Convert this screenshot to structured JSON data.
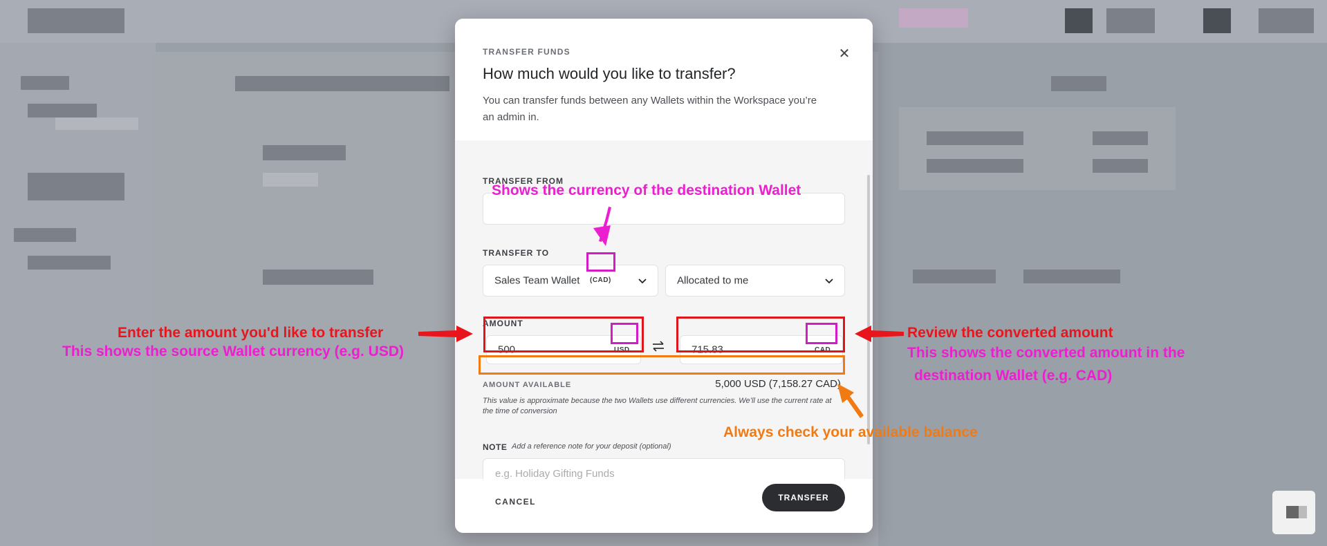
{
  "modal": {
    "eyebrow": "TRANSFER FUNDS",
    "title": "How much would you like to transfer?",
    "subtitle": "You can transfer funds between any Wallets within the Workspace you’re an admin in.",
    "close_icon": "close-icon",
    "transfer_from": {
      "label": "TRANSFER FROM",
      "value": ""
    },
    "transfer_to": {
      "label": "TRANSFER TO",
      "wallet_value": "Sales Team Wallet",
      "wallet_currency": "(CAD)",
      "allocation_value": "Allocated to me"
    },
    "amount": {
      "label": "AMOUNT",
      "source_value": "500",
      "source_currency": "USD",
      "converted_value": "715.83",
      "converted_currency": "CAD",
      "swap_icon": "swap-arrows-icon"
    },
    "available": {
      "label": "AMOUNT AVAILABLE",
      "value": "5,000 USD (7,158.27 CAD)",
      "disclaimer": "This value is approximate because the two Wallets use different currencies. We’ll use the current rate at the time of conversion"
    },
    "note": {
      "label": "NOTE",
      "hint": "Add a reference note for your deposit (optional)",
      "placeholder": "e.g. Holiday Gifting Funds"
    },
    "footer": {
      "cancel_label": "CANCEL",
      "transfer_label": "TRANSFER"
    }
  },
  "annotations": {
    "destination_currency": "Shows the currency of the destination Wallet",
    "enter_amount": "Enter the amount you'd like to transfer",
    "source_currency_hint": "This shows the source Wallet currency (e.g. USD)",
    "review_converted": "Review the converted amount",
    "converted_hint_line1": "This shows the converted amount in the",
    "converted_hint_line2": "destination Wallet (e.g. CAD)",
    "check_balance": "Always check your available balance"
  },
  "colors": {
    "annotation_red": "#e8151d",
    "annotation_magenta": "#ec1fd0",
    "annotation_orange": "#f27a12",
    "primary_button": "#2b2d30"
  }
}
